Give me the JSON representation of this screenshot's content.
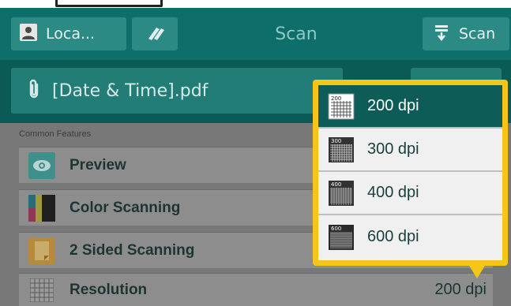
{
  "header": {
    "local_label": "Loca...",
    "title": "Scan",
    "scan_button_label": "Scan"
  },
  "file": {
    "name": "[Date & Time].pdf"
  },
  "features": {
    "section_title": "Common Features",
    "items": [
      {
        "label": "Preview",
        "value": ""
      },
      {
        "label": "Color Scanning",
        "value": ""
      },
      {
        "label": "2 Sided Scanning",
        "value": ""
      },
      {
        "label": "Resolution",
        "value": "200 dpi"
      }
    ]
  },
  "resolution_menu": {
    "options": [
      {
        "label": "200 dpi",
        "icon_text": "200",
        "selected": true
      },
      {
        "label": "300 dpi",
        "icon_text": "300",
        "selected": false
      },
      {
        "label": "400 dpi",
        "icon_text": "400",
        "selected": false
      },
      {
        "label": "600 dpi",
        "icon_text": "600",
        "selected": false
      }
    ]
  },
  "colors": {
    "toolbar": "#0d6e6a",
    "selected_option": "#0d5c57",
    "popup_border": "#f5c518"
  }
}
